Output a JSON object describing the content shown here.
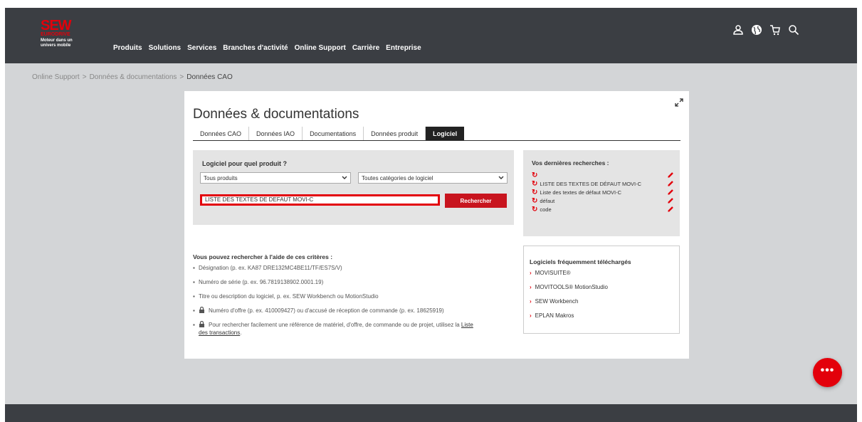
{
  "header": {
    "logo_main": "SEW",
    "logo_sub": "EURODRIVE",
    "tagline_1": "Moteur dans un",
    "tagline_2": "univers mobile",
    "nav": [
      "Produits",
      "Solutions",
      "Services",
      "Branches d'activité",
      "Online Support",
      "Carrière",
      "Entreprise"
    ],
    "icons": [
      "user-icon",
      "globe-icon",
      "cart-icon",
      "search-icon"
    ]
  },
  "breadcrumb": {
    "items": [
      "Online Support",
      "Données & documentations",
      "Données CAO"
    ],
    "separator": ">"
  },
  "page": {
    "title": "Données & documentations",
    "tabs": [
      "Données CAO",
      "Données IAO",
      "Documentations",
      "Données produit",
      "Logiciel"
    ],
    "active_tab": "Logiciel"
  },
  "search": {
    "label": "Logiciel pour quel produit ?",
    "product_select": "Tous produits",
    "category_select": "Toutes catégories de logiciel",
    "query": "LISTE DES TEXTES DE DEFAUT MOVI-C",
    "button": "Rechercher"
  },
  "recent": {
    "title": "Vos dernières recherches :",
    "items": [
      "",
      "LISTE DES TEXTES DE DÉFAUT MOVI-C",
      "Liste des textes de défaut MOVI-C",
      "défaut",
      "code"
    ]
  },
  "frequent": {
    "title": "Logiciels fréquemment téléchargés",
    "items": [
      "MOVISUITE®",
      "MOVITOOLS® MotionStudio",
      "SEW Workbench",
      "EPLAN Makros"
    ]
  },
  "criteria": {
    "title": "Vous pouvez rechercher à l'aide de ces critères :",
    "items": [
      "Désignation (p. ex. KA87 DRE132MC4BE11/TF/ES7S/V)",
      "Numéro de série (p. ex. 96.7819138902.0001.19)",
      "Titre ou description du logiciel, p. ex. SEW Workbench ou MotionStudio",
      "Numéro d'offre (p. ex. 410009427) ou d'accusé de réception de commande (p. ex. 18625919)",
      "Pour rechercher facilement une référence de matériel, d'offre, de commande ou de projet, utilisez la"
    ],
    "link_1": "Liste",
    "link_2": "des transactions",
    "link_end": "."
  },
  "fab": {
    "label": "•••"
  },
  "colors": {
    "brand_red": "#e3000b",
    "topbar": "#3b3e43",
    "background": "#d3d5d7"
  }
}
